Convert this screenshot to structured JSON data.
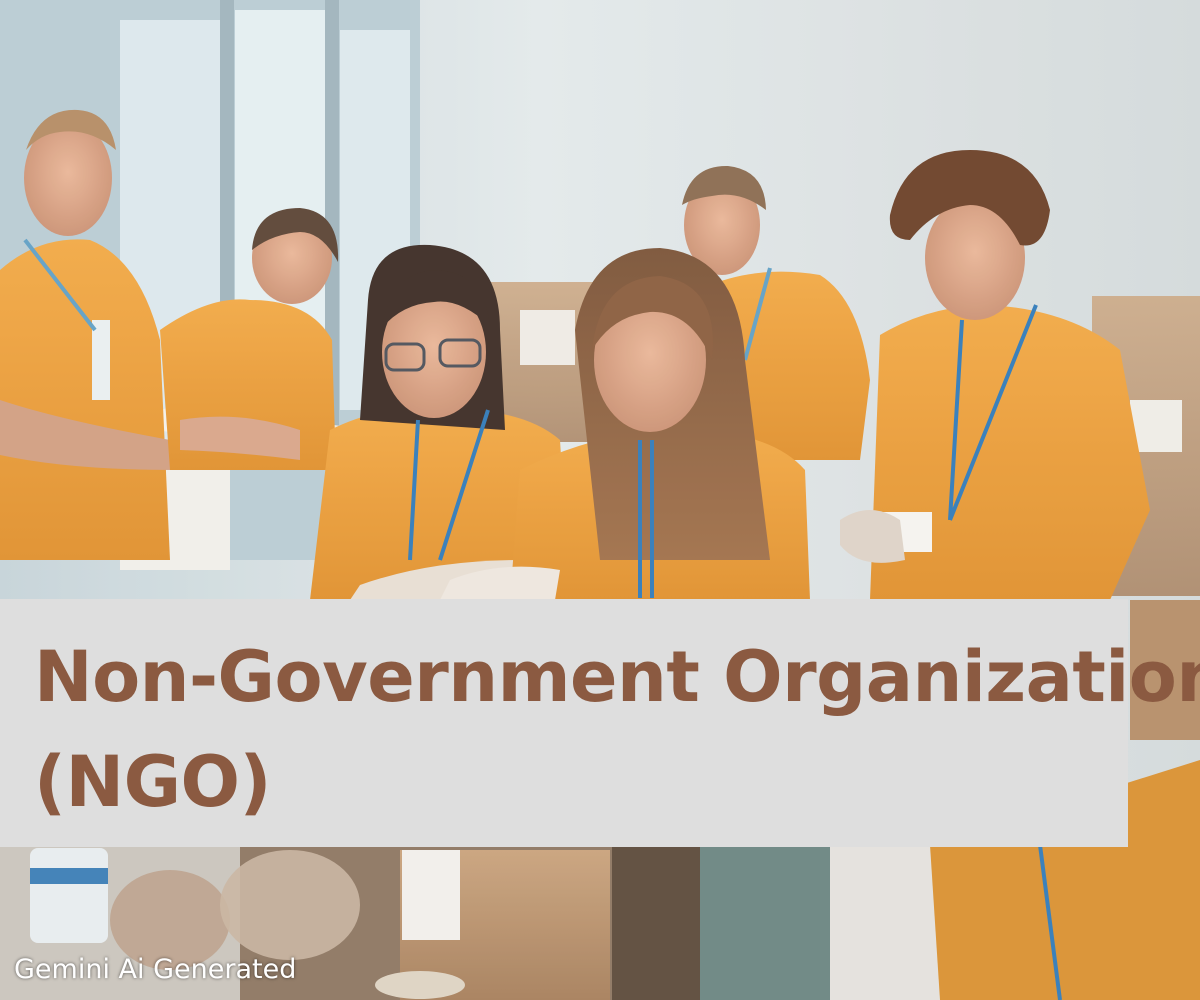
{
  "banner": {
    "title_line_1": "Non-Government Organization",
    "title_line_2": "(NGO)",
    "text_color": "#8b5a41",
    "background_color": "#dedede"
  },
  "caption": "Gemini Ai Generated",
  "photo": {
    "description_icon": "volunteers-photo",
    "shirt_color": "#f0a23a"
  }
}
